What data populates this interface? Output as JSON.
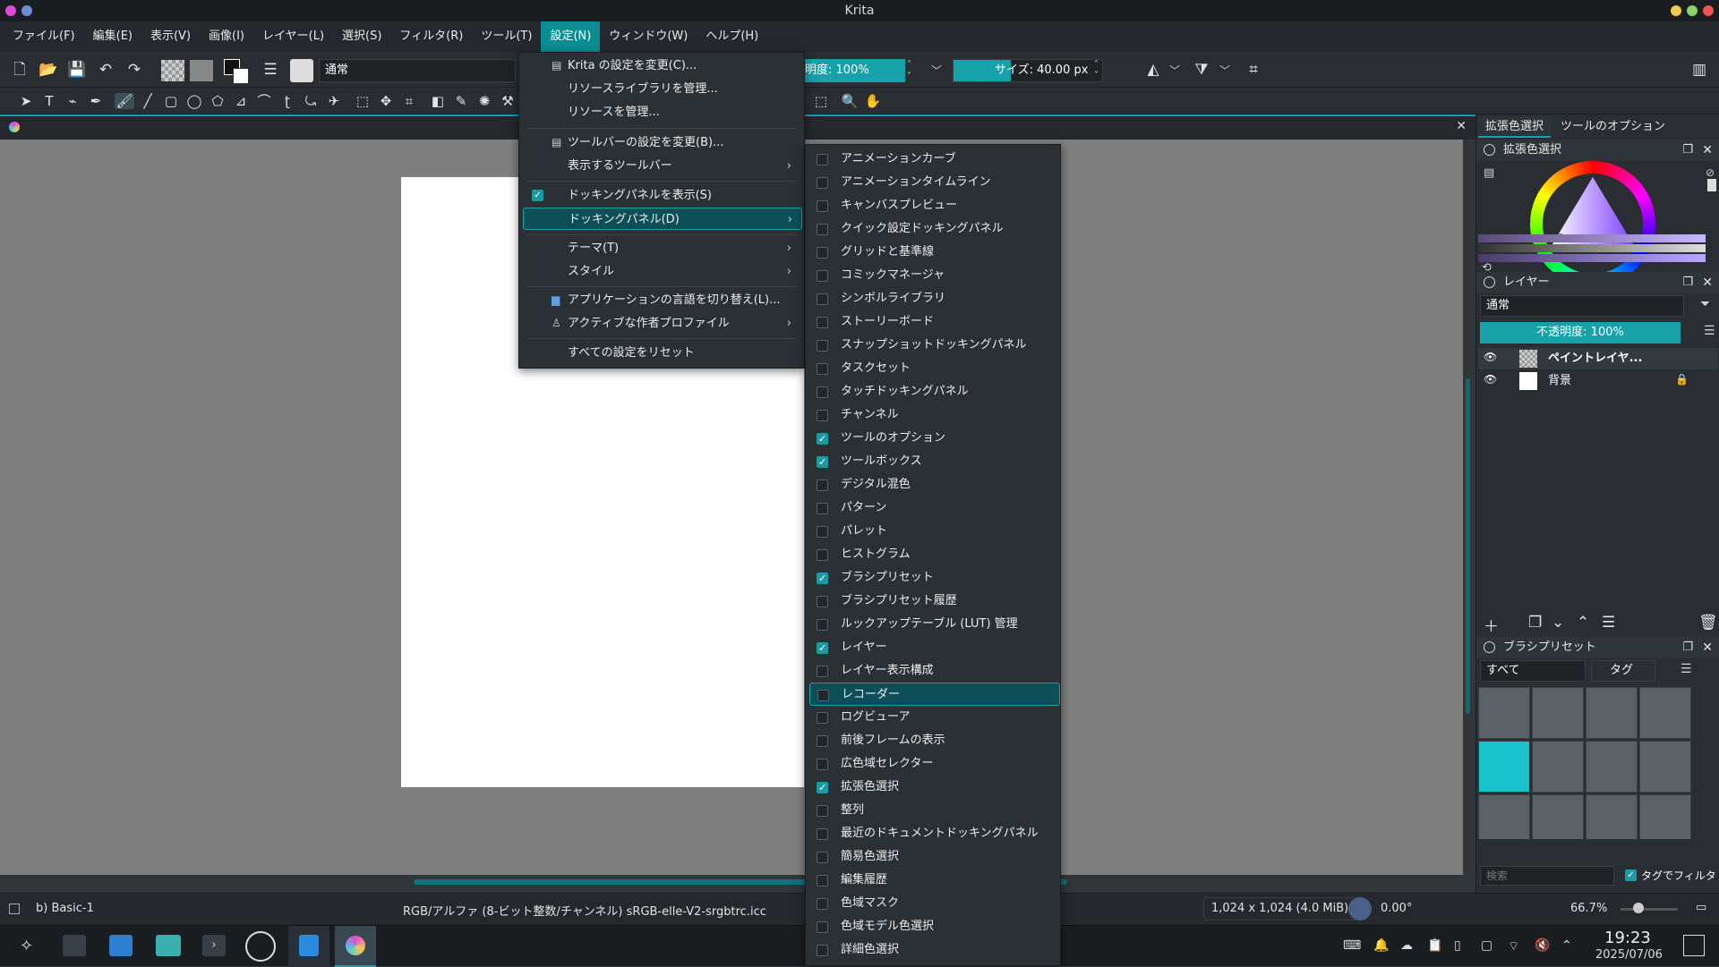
{
  "window": {
    "title": "Krita"
  },
  "menubar": [
    "ファイル(F)",
    "編集(E)",
    "表示(V)",
    "画像(I)",
    "レイヤー(L)",
    "選択(S)",
    "フィルタ(R)",
    "ツール(T)",
    "設定(N)",
    "ウィンドウ(W)",
    "ヘルプ(H)"
  ],
  "toolbar": {
    "blend_mode": "通常",
    "opacity_label": "明度: 100%",
    "size_label": "サイズ: 40.00 px"
  },
  "settings_menu": {
    "items": [
      "Krita の設定を変更(C)...",
      "リソースライブラリを管理...",
      "リソースを管理...",
      "ツールバーの設定を変更(B)...",
      "表示するツールバー",
      "ドッキングパネルを表示(S)",
      "ドッキングパネル(D)",
      "テーマ(T)",
      "スタイル",
      "アプリケーションの言語を切り替え(L)...",
      "アクティブな作者プロファイル",
      "すべての設定をリセット"
    ]
  },
  "dockers_menu": [
    {
      "label": "アニメーションカーブ",
      "checked": false
    },
    {
      "label": "アニメーションタイムライン",
      "checked": false
    },
    {
      "label": "キャンバスプレビュー",
      "checked": false
    },
    {
      "label": "クイック設定ドッキングパネル",
      "checked": false
    },
    {
      "label": "グリッドと基準線",
      "checked": false
    },
    {
      "label": "コミックマネージャ",
      "checked": false
    },
    {
      "label": "シンボルライブラリ",
      "checked": false
    },
    {
      "label": "ストーリーボード",
      "checked": false
    },
    {
      "label": "スナップショットドッキングパネル",
      "checked": false
    },
    {
      "label": "タスクセット",
      "checked": false
    },
    {
      "label": "タッチドッキングパネル",
      "checked": false
    },
    {
      "label": "チャンネル",
      "checked": false
    },
    {
      "label": "ツールのオプション",
      "checked": true
    },
    {
      "label": "ツールボックス",
      "checked": true
    },
    {
      "label": "デジタル混色",
      "checked": false
    },
    {
      "label": "パターン",
      "checked": false
    },
    {
      "label": "パレット",
      "checked": false
    },
    {
      "label": "ヒストグラム",
      "checked": false
    },
    {
      "label": "ブラシプリセット",
      "checked": true
    },
    {
      "label": "ブラシプリセット履歴",
      "checked": false
    },
    {
      "label": "ルックアップテーブル (LUT) 管理",
      "checked": false
    },
    {
      "label": "レイヤー",
      "checked": true
    },
    {
      "label": "レイヤー表示構成",
      "checked": false
    },
    {
      "label": "レコーダー",
      "checked": false
    },
    {
      "label": "ログビューア",
      "checked": false
    },
    {
      "label": "前後フレームの表示",
      "checked": false
    },
    {
      "label": "広色域セレクター",
      "checked": false
    },
    {
      "label": "拡張色選択",
      "checked": true
    },
    {
      "label": "整列",
      "checked": false
    },
    {
      "label": "最近のドキュメントドッキングパネル",
      "checked": false
    },
    {
      "label": "簡易色選択",
      "checked": false
    },
    {
      "label": "編集履歴",
      "checked": false
    },
    {
      "label": "色域マスク",
      "checked": false
    },
    {
      "label": "色域モデル色選択",
      "checked": false
    },
    {
      "label": "詳細色選択",
      "checked": false
    }
  ],
  "right_panel": {
    "tabs": [
      "拡張色選択",
      "ツールのオプション"
    ],
    "color_docker_title": "拡張色選択",
    "layers_title": "レイヤー",
    "layers_blend": "通常",
    "layers_opacity": "不透明度: 100%",
    "layers": [
      {
        "name": "ペイントレイヤ..."
      },
      {
        "name": "背景"
      }
    ],
    "brush_title": "ブラシプリセット",
    "brush_filter": "すべて",
    "brush_tag": "タグ",
    "brush_search_placeholder": "検索",
    "brush_tag_filter": "タグでフィルタ"
  },
  "status": {
    "preset": "b) Basic-1",
    "color_info": "RGB/アルファ (8-ビット整数/チャンネル)  sRGB-elle-V2-srgbtrc.icc",
    "image_size": "1,024 x 1,024 (4.0 MiB)",
    "rotation": "0.00°",
    "zoom": "66.7%"
  },
  "taskbar": {
    "time": "19:23",
    "date": "2025/07/06"
  },
  "colors": {
    "accent": "#17a2aa",
    "menu_bg": "#2b3035",
    "panel_bg": "#2a2e32"
  }
}
